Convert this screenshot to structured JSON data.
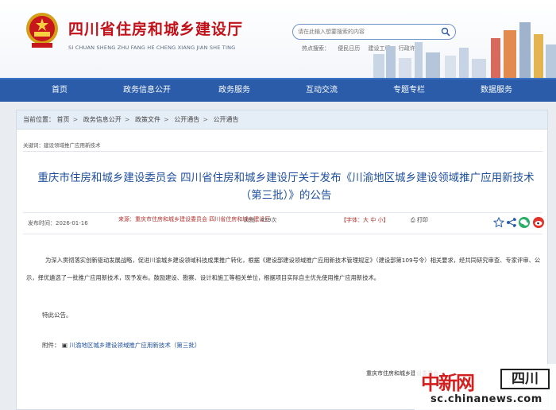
{
  "header": {
    "site_title": "四川省住房和城乡建设厅",
    "site_pinyin": "SI CHUAN SHENG ZHU FANG HE CHENG XIANG JIAN SHE TING",
    "search_placeholder": "请在此输入想要搜索的内容",
    "quicklinks": [
      "热点搜索：",
      "便民日历",
      "建设工程",
      "行政许可"
    ]
  },
  "nav": [
    "首页",
    "政务信息公开",
    "政务服务",
    "互动交流",
    "专题专栏",
    "数据服务"
  ],
  "breadcrumb": {
    "label": "当前位置：",
    "items": [
      "首页",
      "政务信息公开",
      "政策文件",
      "公开通告",
      "公开通告"
    ]
  },
  "keywords": "关键词：建设领域推广应用新技术",
  "article": {
    "title": "重庆市住房和城乡建设委员会 四川省住房和城乡建设厅关于发布《川渝地区城乡建设领域推广应用新技术（第三批）》的公告",
    "date": "发布时间：2026-01-16",
    "source": "来源：重庆市住房和城乡建设委员会 四川省住房和城乡建设厅",
    "views": "浏览：439次",
    "fontsize": "【字体：大 中 小】",
    "print": "打印",
    "body": "为深入贯彻落实创新驱动发展战略，促进川渝城乡建设领域科技成果推广转化，根据《建设部建设领域推广应用新技术管理规定》（建设部第109号令）相关要求，经共同研究审查、专家评审、公示，择优遴选了一批推广应用新技术，现予发布。鼓励建设、勘察、设计和施工等相关单位，根据项目实际自主优先使用推广应用新技术。",
    "special": "特此公告。",
    "attachment_label": "附件：",
    "attachment_link": "川渝地区城乡建设领域推广应用新技术（第三批）",
    "signer": "重庆市住房和城乡建设委员会"
  },
  "watermark": {
    "brand": "中新网",
    "region": "四川",
    "url": "sc.chinanews.com"
  },
  "colors": {
    "nav_bg": "#2a5caa",
    "title_blue": "#1e4f9e",
    "brand_red": "#c1121a"
  }
}
